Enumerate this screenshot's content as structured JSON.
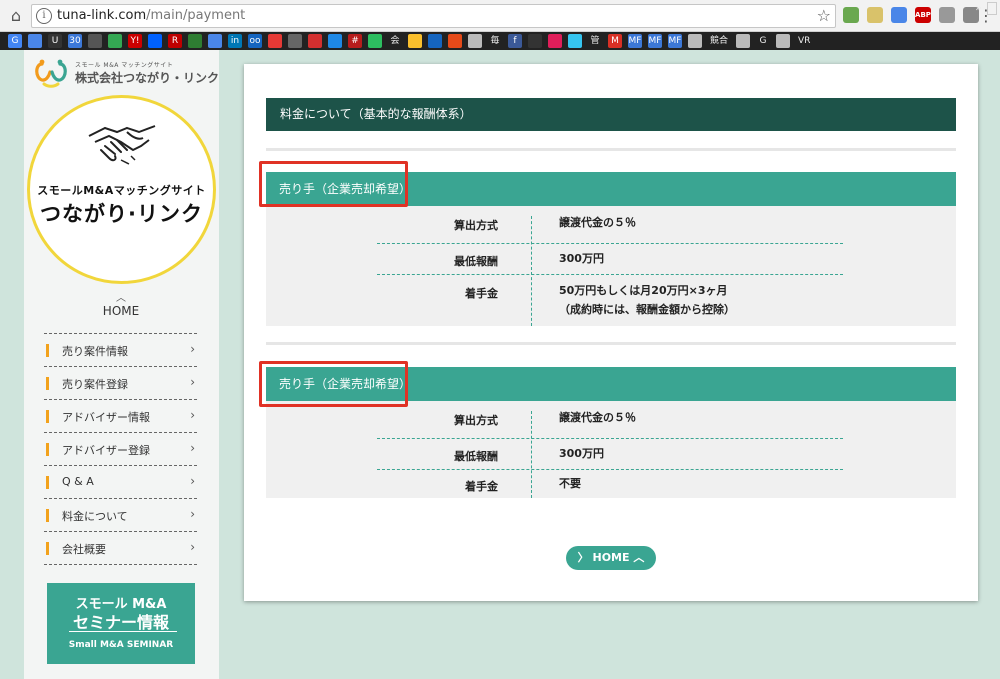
{
  "browser": {
    "url_domain": "tuna-link.com",
    "url_path": "/main/payment",
    "extensions": [
      {
        "name": "ext-icon",
        "color": "#6aa84f"
      },
      {
        "name": "ext-icon",
        "color": "#d9c26a"
      },
      {
        "name": "translate-icon",
        "color": "#4a86e8"
      },
      {
        "name": "abp-icon",
        "color": "#cc0000",
        "text": "ABP"
      },
      {
        "name": "ext-icon",
        "color": "#999999"
      },
      {
        "name": "cast-icon",
        "color": "#888888"
      }
    ],
    "bookmarks": [
      {
        "type": "icon",
        "name": "google-icon",
        "color": "#4285f4",
        "text": "G"
      },
      {
        "type": "icon",
        "name": "translate-icon",
        "color": "#4a86e8",
        "text": ""
      },
      {
        "type": "icon",
        "name": "bookmark-icon",
        "color": "#333333",
        "text": "U"
      },
      {
        "type": "icon",
        "name": "calendar-icon",
        "color": "#3c78d8",
        "text": "30"
      },
      {
        "type": "icon",
        "name": "bookmark-icon",
        "color": "#555555",
        "text": ""
      },
      {
        "type": "icon",
        "name": "maps-icon",
        "color": "#34a853",
        "text": ""
      },
      {
        "type": "icon",
        "name": "yahoo-icon",
        "color": "#cc0000",
        "text": "Y!"
      },
      {
        "type": "icon",
        "name": "dropbox-icon",
        "color": "#0061ff",
        "text": ""
      },
      {
        "type": "icon",
        "name": "rakuten-icon",
        "color": "#bf0000",
        "text": "R"
      },
      {
        "type": "icon",
        "name": "bookmark-icon",
        "color": "#2e7d32",
        "text": ""
      },
      {
        "type": "icon",
        "name": "bookmark-icon",
        "color": "#4a86e8",
        "text": ""
      },
      {
        "type": "icon",
        "name": "linkedin-icon",
        "color": "#0077b5",
        "text": "in"
      },
      {
        "type": "icon",
        "name": "bookmark-icon",
        "color": "#1565c0",
        "text": "oo"
      },
      {
        "type": "icon",
        "name": "bookmark-icon",
        "color": "#e53935",
        "text": ""
      },
      {
        "type": "icon",
        "name": "apple-icon",
        "color": "#666666",
        "text": ""
      },
      {
        "type": "icon",
        "name": "bookmark-icon",
        "color": "#d32f2f",
        "text": ""
      },
      {
        "type": "icon",
        "name": "bookmark-icon",
        "color": "#1e88e5",
        "text": ""
      },
      {
        "type": "icon",
        "name": "hash-icon",
        "color": "#b71c1c",
        "text": "#"
      },
      {
        "type": "icon",
        "name": "evernote-icon",
        "color": "#2dbe60",
        "text": ""
      },
      {
        "type": "text",
        "text": "会"
      },
      {
        "type": "icon",
        "name": "bookmark-icon",
        "color": "#fbc02d",
        "text": ""
      },
      {
        "type": "icon",
        "name": "bookmark-icon",
        "color": "#1565c0",
        "text": ""
      },
      {
        "type": "icon",
        "name": "bookmark-icon",
        "color": "#e64a19",
        "text": ""
      },
      {
        "type": "icon",
        "name": "folder-icon",
        "color": "#bbbbbb",
        "text": ""
      },
      {
        "type": "text",
        "text": "毎"
      },
      {
        "type": "icon",
        "name": "facebook-icon",
        "color": "#3b5998",
        "text": "f"
      },
      {
        "type": "icon",
        "name": "bookmark-icon",
        "color": "#333333",
        "text": ""
      },
      {
        "type": "icon",
        "name": "slack-icon",
        "color": "#e01e5a",
        "text": ""
      },
      {
        "type": "icon",
        "name": "slack-icon",
        "color": "#36c5f0",
        "text": ""
      },
      {
        "type": "text",
        "text": "管"
      },
      {
        "type": "icon",
        "name": "gmail-icon",
        "color": "#d93025",
        "text": "M"
      },
      {
        "type": "icon",
        "name": "mf-icon",
        "color": "#3c78d8",
        "text": "MF"
      },
      {
        "type": "icon",
        "name": "mf-icon",
        "color": "#3c78d8",
        "text": "MF"
      },
      {
        "type": "icon",
        "name": "mf-icon",
        "color": "#3c78d8",
        "text": "MF"
      },
      {
        "type": "icon",
        "name": "folder-icon",
        "color": "#bbbbbb",
        "text": ""
      },
      {
        "type": "text",
        "text": "競合"
      },
      {
        "type": "icon",
        "name": "folder-icon",
        "color": "#bbbbbb",
        "text": ""
      },
      {
        "type": "text",
        "text": "G"
      },
      {
        "type": "icon",
        "name": "folder-icon",
        "color": "#bbbbbb",
        "text": ""
      },
      {
        "type": "text",
        "text": "VR"
      }
    ],
    "more_label": "»"
  },
  "site": {
    "logo_small": "スモール M&A マッチングサイト",
    "logo_name": "株式会社つながり・リンク",
    "banner_sub": "スモールM&Aマッチングサイト",
    "banner_main": "つながり·リンク",
    "home_caret": "︿",
    "home_label": "HOME"
  },
  "sidebar": {
    "chevron": "›",
    "items": [
      {
        "label": "売り案件情報"
      },
      {
        "label": "売り案件登録"
      },
      {
        "label": "アドバイザー情報"
      },
      {
        "label": "アドバイザー登録"
      },
      {
        "label": "Q & A"
      },
      {
        "label": "料金について"
      },
      {
        "label": "会社概要"
      }
    ]
  },
  "seminar": {
    "line1": "スモール M&A",
    "line2": "セミナー情報",
    "line3": "Small M&A SEMINAR"
  },
  "main": {
    "section_title": "料金について（基本的な報酬体系）",
    "blocks": [
      {
        "header": "売り手（企業売却希望）",
        "rows": [
          {
            "key": "算出方式",
            "value": "譲渡代金の５％"
          },
          {
            "key": "最低報酬",
            "value": "300万円"
          },
          {
            "key": "着手金",
            "value": "50万円もしくは月20万円×3ヶ月",
            "value2": "（成約時には、報酬金額から控除）"
          }
        ]
      },
      {
        "header": "売り手（企業売却希望）",
        "rows": [
          {
            "key": "算出方式",
            "value": "譲渡代金の５％"
          },
          {
            "key": "最低報酬",
            "value": "300万円"
          },
          {
            "key": "着手金",
            "value": "不要"
          }
        ]
      }
    ],
    "home_button": "〉 HOME ︿"
  },
  "colors": {
    "teal": "#3aa592",
    "dark_teal": "#1d5349",
    "accent_orange": "#f2a21c",
    "highlight_red": "#e03225",
    "banner_yellow": "#f1d63b"
  }
}
